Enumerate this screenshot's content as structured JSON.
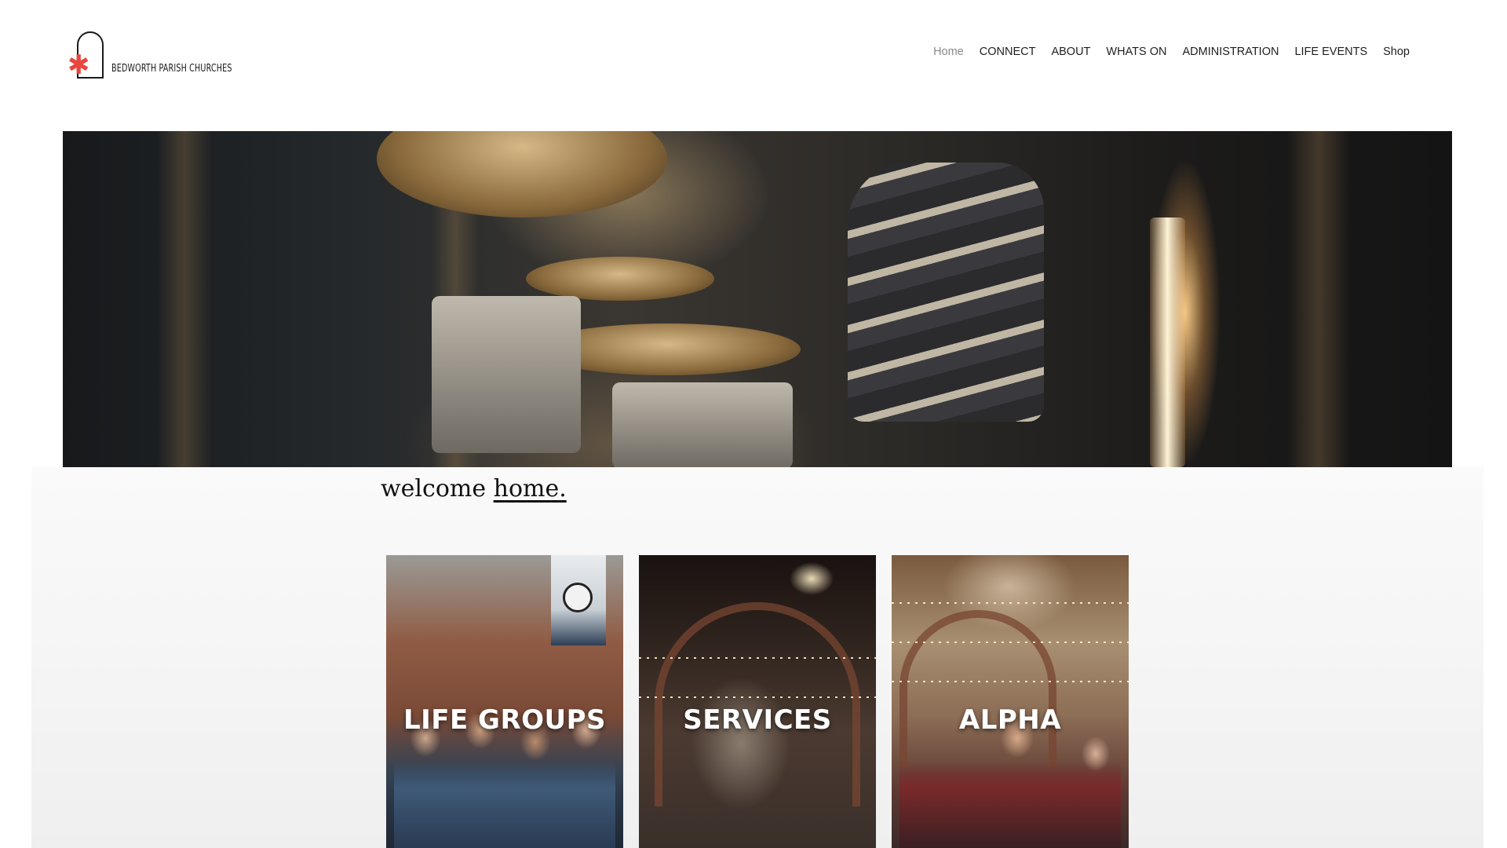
{
  "site": {
    "logo_text": "BEDWORTH PARISH CHURCHES",
    "brand_color": "#e8463f"
  },
  "nav": {
    "items": [
      {
        "label": "Home",
        "active": true
      },
      {
        "label": "CONNECT",
        "active": false
      },
      {
        "label": "ABOUT",
        "active": false
      },
      {
        "label": "WHATS ON",
        "active": false
      },
      {
        "label": "ADMINISTRATION",
        "active": false
      },
      {
        "label": "LIFE EVENTS",
        "active": false
      },
      {
        "label": "Shop",
        "active": false
      }
    ]
  },
  "welcome": {
    "prefix": "welcome",
    "link": "home."
  },
  "cards": [
    {
      "label": "LIFE GROUPS"
    },
    {
      "label": "SERVICES"
    },
    {
      "label": "ALPHA"
    }
  ]
}
